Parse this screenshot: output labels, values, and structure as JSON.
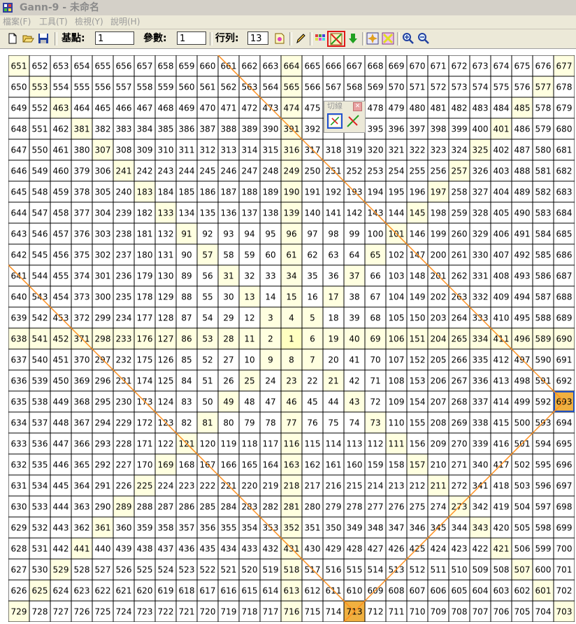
{
  "window": {
    "title": "Gann-9 - 未命名"
  },
  "menu": [
    {
      "label": "檔案(F)"
    },
    {
      "label": "工具(T)"
    },
    {
      "label": "檢視(Y)"
    },
    {
      "label": "說明(H)"
    }
  ],
  "toolbar": {
    "base_label": "基點:",
    "base_value": "1",
    "param_label": "參數:",
    "param_value": "1",
    "rows_label": "行列:",
    "rows_value": "13",
    "icons": [
      "new-file-icon",
      "open-folder-icon",
      "save-icon",
      "calc-icon",
      "pencil-icon",
      "grid-color-icon",
      "cut-line-icon",
      "arrow-down-icon",
      "grid-star-icon",
      "clear-icon",
      "zoom-in-icon",
      "zoom-out-icon"
    ]
  },
  "cut_panel": {
    "title": "切線",
    "close": "✕",
    "icons": [
      "cut-line-a-icon",
      "cut-line-b-icon"
    ]
  },
  "grid": {
    "size": 27,
    "rows": [
      [
        651,
        652,
        653,
        654,
        655,
        656,
        657,
        658,
        659,
        660,
        661,
        662,
        663,
        664,
        665,
        666,
        667,
        668,
        669,
        670,
        671,
        672,
        673,
        674,
        675,
        676,
        677
      ],
      [
        650,
        553,
        554,
        555,
        556,
        557,
        558,
        559,
        560,
        561,
        562,
        563,
        564,
        565,
        566,
        567,
        568,
        569,
        570,
        571,
        572,
        573,
        574,
        575,
        576,
        577,
        678
      ],
      [
        649,
        552,
        463,
        464,
        465,
        466,
        467,
        468,
        469,
        470,
        471,
        472,
        473,
        474,
        475,
        476,
        477,
        478,
        479,
        480,
        481,
        482,
        483,
        484,
        485,
        578,
        679
      ],
      [
        648,
        551,
        462,
        381,
        382,
        383,
        384,
        385,
        386,
        387,
        388,
        389,
        390,
        391,
        392,
        393,
        394,
        395,
        396,
        397,
        398,
        399,
        400,
        401,
        486,
        579,
        680
      ],
      [
        647,
        550,
        461,
        380,
        307,
        308,
        309,
        310,
        311,
        312,
        313,
        314,
        315,
        316,
        317,
        318,
        319,
        320,
        321,
        322,
        323,
        324,
        325,
        402,
        487,
        580,
        681
      ],
      [
        646,
        549,
        460,
        379,
        306,
        241,
        242,
        243,
        244,
        245,
        246,
        247,
        248,
        249,
        250,
        251,
        252,
        253,
        254,
        255,
        256,
        257,
        326,
        403,
        488,
        581,
        682
      ],
      [
        645,
        548,
        459,
        378,
        305,
        240,
        183,
        184,
        185,
        186,
        187,
        188,
        189,
        190,
        191,
        192,
        193,
        194,
        195,
        196,
        197,
        258,
        327,
        404,
        489,
        582,
        683
      ],
      [
        644,
        547,
        458,
        377,
        304,
        239,
        182,
        133,
        134,
        135,
        136,
        137,
        138,
        139,
        140,
        141,
        142,
        143,
        144,
        145,
        198,
        259,
        328,
        405,
        490,
        583,
        684
      ],
      [
        643,
        546,
        457,
        376,
        303,
        238,
        181,
        132,
        91,
        92,
        93,
        94,
        95,
        96,
        97,
        98,
        99,
        100,
        101,
        146,
        199,
        260,
        329,
        406,
        491,
        584,
        685
      ],
      [
        642,
        545,
        456,
        375,
        302,
        237,
        180,
        131,
        90,
        57,
        58,
        59,
        60,
        61,
        62,
        63,
        64,
        65,
        102,
        147,
        200,
        261,
        330,
        407,
        492,
        585,
        686
      ],
      [
        641,
        544,
        455,
        374,
        301,
        236,
        179,
        130,
        89,
        56,
        31,
        32,
        33,
        34,
        35,
        36,
        37,
        66,
        103,
        148,
        201,
        262,
        331,
        408,
        493,
        586,
        687
      ],
      [
        640,
        543,
        454,
        373,
        300,
        235,
        178,
        129,
        88,
        55,
        30,
        13,
        14,
        15,
        16,
        17,
        38,
        67,
        104,
        149,
        202,
        263,
        332,
        409,
        494,
        587,
        688
      ],
      [
        639,
        542,
        453,
        372,
        299,
        234,
        177,
        128,
        87,
        54,
        29,
        12,
        3,
        4,
        5,
        18,
        39,
        68,
        105,
        150,
        203,
        264,
        333,
        410,
        495,
        588,
        689
      ],
      [
        638,
        541,
        452,
        371,
        298,
        233,
        176,
        127,
        86,
        53,
        28,
        11,
        2,
        1,
        6,
        19,
        40,
        69,
        106,
        151,
        204,
        265,
        334,
        411,
        496,
        589,
        690
      ],
      [
        637,
        540,
        451,
        370,
        297,
        232,
        175,
        126,
        85,
        52,
        27,
        10,
        9,
        8,
        7,
        20,
        41,
        70,
        107,
        152,
        205,
        266,
        335,
        412,
        497,
        590,
        691
      ],
      [
        636,
        539,
        450,
        369,
        296,
        231,
        174,
        125,
        84,
        51,
        26,
        25,
        24,
        23,
        22,
        21,
        42,
        71,
        108,
        153,
        206,
        267,
        336,
        413,
        498,
        591,
        692
      ],
      [
        635,
        538,
        449,
        368,
        295,
        230,
        173,
        124,
        83,
        50,
        49,
        48,
        47,
        46,
        45,
        44,
        43,
        72,
        109,
        154,
        207,
        268,
        337,
        414,
        499,
        592,
        693
      ],
      [
        634,
        537,
        448,
        367,
        294,
        229,
        172,
        123,
        82,
        81,
        80,
        79,
        78,
        77,
        76,
        75,
        74,
        73,
        110,
        155,
        208,
        269,
        338,
        415,
        500,
        593,
        694
      ],
      [
        633,
        536,
        447,
        366,
        293,
        228,
        171,
        122,
        121,
        120,
        119,
        118,
        117,
        116,
        115,
        114,
        113,
        112,
        111,
        156,
        209,
        270,
        339,
        416,
        501,
        594,
        695
      ],
      [
        632,
        535,
        446,
        365,
        292,
        227,
        170,
        169,
        168,
        167,
        166,
        165,
        164,
        163,
        162,
        161,
        160,
        159,
        158,
        157,
        210,
        271,
        340,
        417,
        502,
        595,
        696
      ],
      [
        631,
        534,
        445,
        364,
        291,
        226,
        225,
        224,
        223,
        222,
        221,
        220,
        219,
        218,
        217,
        216,
        215,
        214,
        213,
        212,
        211,
        272,
        341,
        418,
        503,
        596,
        697
      ],
      [
        630,
        533,
        444,
        363,
        290,
        289,
        288,
        287,
        286,
        285,
        284,
        283,
        282,
        281,
        280,
        279,
        278,
        277,
        276,
        275,
        274,
        273,
        342,
        419,
        504,
        597,
        698
      ],
      [
        629,
        532,
        443,
        362,
        361,
        360,
        359,
        358,
        357,
        356,
        355,
        354,
        353,
        352,
        351,
        350,
        349,
        348,
        347,
        346,
        345,
        344,
        343,
        420,
        505,
        598,
        699
      ],
      [
        628,
        531,
        442,
        441,
        440,
        439,
        438,
        437,
        436,
        435,
        434,
        433,
        432,
        431,
        430,
        429,
        428,
        427,
        426,
        425,
        424,
        423,
        422,
        421,
        506,
        599,
        700
      ],
      [
        627,
        530,
        529,
        528,
        527,
        526,
        525,
        524,
        523,
        522,
        521,
        520,
        519,
        518,
        517,
        516,
        515,
        514,
        513,
        512,
        511,
        510,
        509,
        508,
        507,
        600,
        701
      ],
      [
        626,
        625,
        624,
        623,
        622,
        621,
        620,
        619,
        618,
        617,
        616,
        615,
        614,
        613,
        612,
        611,
        610,
        609,
        608,
        607,
        606,
        605,
        604,
        603,
        602,
        601,
        702
      ],
      [
        729,
        728,
        727,
        726,
        725,
        724,
        723,
        722,
        721,
        720,
        719,
        718,
        717,
        716,
        715,
        714,
        713,
        712,
        711,
        710,
        709,
        708,
        707,
        706,
        705,
        704,
        703
      ]
    ],
    "center_value": 1,
    "highlight_values": [
      693,
      713
    ],
    "colors": {
      "cell_bg": "#ffffff",
      "cell_highlight": "#ffffe0",
      "center_bg": "#ffffc0",
      "selected_bg": "#f0b040",
      "grid_line": "#000000",
      "cut_line": "#ff9020",
      "selected_border": "#2050c0"
    }
  }
}
